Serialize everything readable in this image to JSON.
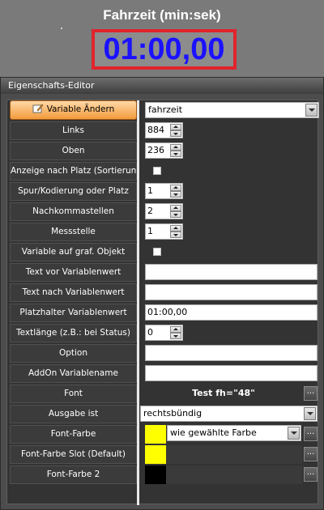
{
  "preview": {
    "title": "Fahrzeit (min:sek)",
    "value": "01:00,00",
    "value_color": "#1b12ff",
    "box_border_color": "#e0242c"
  },
  "editor": {
    "title": "Eigenschafts-Editor",
    "rows": [
      {
        "label": "Variable Ändern",
        "value": "fahrzeit"
      },
      {
        "label": "Links",
        "value": "884"
      },
      {
        "label": "Oben",
        "value": "236"
      },
      {
        "label": "Anzeige nach Platz (Sortierung)",
        "checked": false
      },
      {
        "label": "Spur/Kodierung oder Platz",
        "value": "1"
      },
      {
        "label": "Nachkommastellen",
        "value": "2"
      },
      {
        "label": "Messstelle",
        "value": "1"
      },
      {
        "label": "Variable auf graf. Objekt",
        "checked": false
      },
      {
        "label": "Text vor Variablenwert",
        "value": ""
      },
      {
        "label": "Text nach Variablenwert",
        "value": ""
      },
      {
        "label": "Platzhalter Variablenwert",
        "value": "01:00,00"
      },
      {
        "label": "Textlänge (z.B.: bei Status)",
        "value": "0"
      },
      {
        "label": "Option",
        "value": ""
      },
      {
        "label": "AddOn Variablename",
        "value": ""
      },
      {
        "label": "Font",
        "value": "Test fh=\"48\""
      },
      {
        "label": "Ausgabe ist",
        "value": "rechtsbündig"
      },
      {
        "label": "Font-Farbe",
        "value": "wie gewählte Farbe",
        "color": "#ffff00"
      },
      {
        "label": "Font-Farbe Slot (Default)",
        "color": "#ffff00"
      },
      {
        "label": "Font-Farbe 2",
        "color": "#000000"
      }
    ],
    "ellipsis": "..."
  },
  "icons": {
    "edit": "pencil-icon",
    "dropdown": "chevron-down-icon",
    "spin": "spin-arrows-icon"
  }
}
